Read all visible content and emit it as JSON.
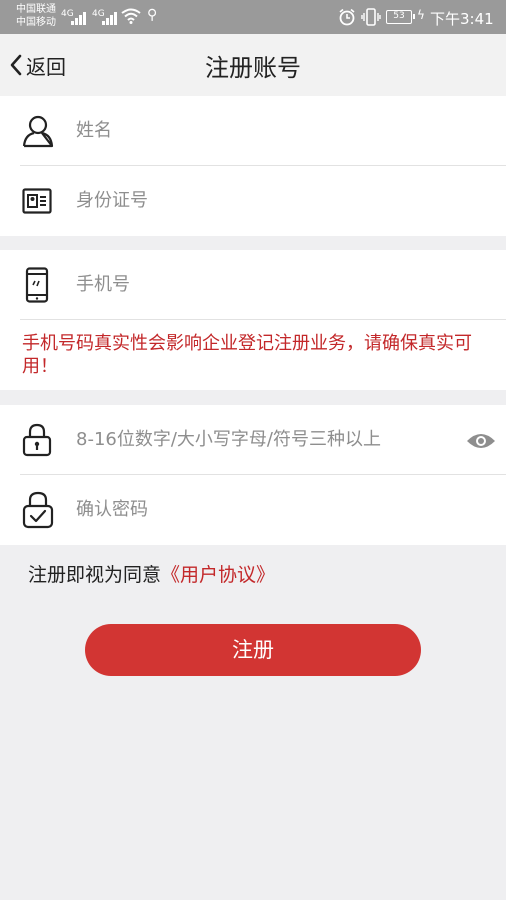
{
  "status_bar": {
    "carrier_1": "中国联通",
    "carrier_2": "中国移动",
    "network_1": "4G",
    "network_2": "4G",
    "battery": "53",
    "time": "下午3:41"
  },
  "header": {
    "back_label": "返回",
    "title": "注册账号"
  },
  "form": {
    "name_placeholder": "姓名",
    "id_placeholder": "身份证号",
    "phone_placeholder": "手机号",
    "phone_warning": "手机号码真实性会影响企业登记注册业务，请确保真实可用！",
    "password_placeholder": "8-16位数字/大小写字母/符号三种以上",
    "confirm_placeholder": "确认密码"
  },
  "agreement": {
    "prefix": "注册即视为同意",
    "link": "《用户协议》"
  },
  "register_button": "注册",
  "colors": {
    "accent": "#d23533",
    "warning": "#c3282a",
    "background": "#efeff1"
  }
}
